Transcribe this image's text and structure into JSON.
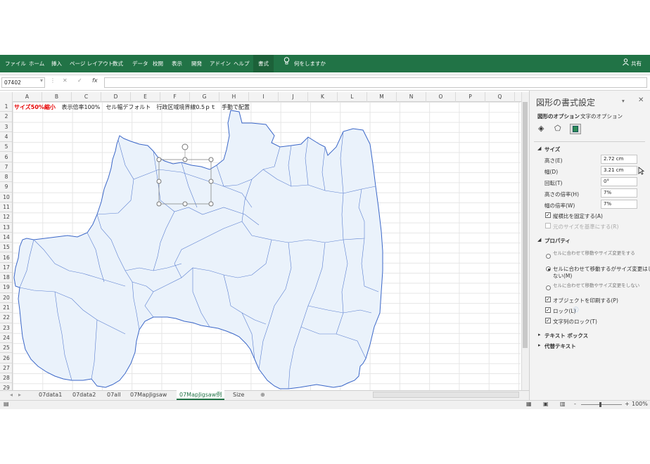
{
  "ribbon": {
    "tabs": [
      "ファイル",
      "ホーム",
      "挿入",
      "ページ レイアウト",
      "数式",
      "データ",
      "校閲",
      "表示",
      "開発",
      "アドイン",
      "ヘルプ",
      "書式"
    ],
    "active_tab": "書式",
    "tell_me": "何をしますか",
    "share": "共有"
  },
  "formula_bar": {
    "name_box": "07402",
    "fx": "fx",
    "value": ""
  },
  "columns": [
    "A",
    "B",
    "C",
    "D",
    "E",
    "F",
    "G",
    "H",
    "I",
    "J",
    "K",
    "L",
    "M",
    "N",
    "O",
    "P",
    "Q"
  ],
  "rows": [
    "1",
    "2",
    "3",
    "4",
    "5",
    "6",
    "7",
    "8",
    "9",
    "10",
    "11",
    "12",
    "13",
    "14",
    "15",
    "16",
    "17",
    "18",
    "19",
    "20",
    "21",
    "22",
    "23",
    "24",
    "25",
    "26",
    "27",
    "28",
    "29"
  ],
  "cell_a1": {
    "highlight": "サイズ50%縮小",
    "rest": "表示倍率100%　セル幅デフォルト　行政区域境界線0.5ｐｔ　手動で配置"
  },
  "sheet_tabs": {
    "items": [
      "07data1",
      "07data2",
      "07all",
      "07MapJigsaw",
      "07MapJigsaw例",
      "Size"
    ],
    "active": "07MapJigsaw例"
  },
  "status": {
    "zoom": "100%",
    "minus": "-",
    "plus": "+"
  },
  "pane": {
    "title": "図形の書式設定",
    "tab_shape": "図形のオプション",
    "tab_text": "文字のオプション",
    "section_size": "サイズ",
    "height_label": "高さ(E)",
    "height_value": "2.72 cm",
    "width_label": "幅(D)",
    "width_value": "3.21 cm",
    "rotation_label": "回転(T)",
    "rotation_value": "0°",
    "scale_h_label": "高さの倍率(H)",
    "scale_h_value": "7%",
    "scale_w_label": "幅の倍率(W)",
    "scale_w_value": "7%",
    "lock_ratio": "縦横比を固定する(A)",
    "relative_size": "元のサイズを基準にする(R)",
    "section_props": "プロパティ",
    "prop_radio1": "セルに合わせて移動やサイズ変更をする",
    "prop_radio2a": "セルに合わせて移動するがサイズ変更はし",
    "prop_radio2b": "ない(M)",
    "prop_radio3": "セルに合わせて移動やサイズ変更をしない",
    "print_object": "オブジェクトを印刷する(P)",
    "lock": "ロック(L)",
    "lock_text": "文字列のロック(T)",
    "section_textbox": "テキスト ボックス",
    "section_alt": "代替テキスト"
  },
  "colors": {
    "excel_green": "#217346",
    "map_fill": "#eaf2fb",
    "map_border": "#3b67c8",
    "red_text": "#e60000"
  }
}
